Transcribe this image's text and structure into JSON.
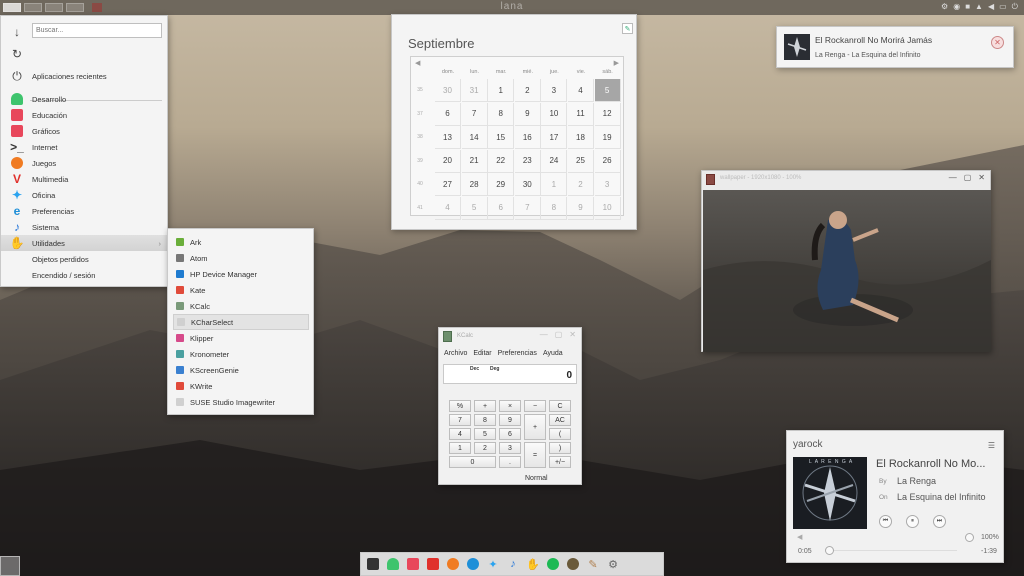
{
  "top_panel": {
    "title": "lana",
    "desktops": [
      "",
      "",
      "",
      ""
    ]
  },
  "app_menu": {
    "search_placeholder": "Buscar...",
    "recent": "Aplicaciones recientes",
    "categories": [
      {
        "label": "Desarrollo",
        "icon": "android-icon",
        "color": "#3ec46d"
      },
      {
        "label": "Educación",
        "icon": "education-icon",
        "color": "#e8475b"
      },
      {
        "label": "Gráficos",
        "icon": "graphics-icon",
        "color": "#e8475b"
      },
      {
        "label": "Internet",
        "icon": "terminal-icon",
        "color": "#333333"
      },
      {
        "label": "Juegos",
        "icon": "firefox-icon",
        "color": "#f07b22"
      },
      {
        "label": "Multimedia",
        "icon": "vivaldi-icon",
        "color": "#e0312c"
      },
      {
        "label": "Oficina",
        "icon": "twitter-icon",
        "color": "#2aa3ef"
      },
      {
        "label": "Preferencias",
        "icon": "edge-icon",
        "color": "#1e8fd8"
      },
      {
        "label": "Sistema",
        "icon": "music-note-icon",
        "color": "#2a79d8"
      },
      {
        "label": "Utilidades",
        "icon": "hand-icon",
        "color": "#f0a040"
      },
      {
        "label": "Objetos perdidos",
        "icon": "",
        "color": ""
      },
      {
        "label": "Encendido / sesión",
        "icon": "",
        "color": ""
      }
    ]
  },
  "utilities_menu": {
    "items": [
      {
        "label": "Ark",
        "color": "#6aae3a"
      },
      {
        "label": "Atom",
        "color": "#777777"
      },
      {
        "label": "HP Device Manager",
        "color": "#1f7bcf"
      },
      {
        "label": "Kate",
        "color": "#e04a3a"
      },
      {
        "label": "KCalc",
        "color": "#7a9a7a"
      },
      {
        "label": "KCharSelect",
        "color": "#d0d0d0"
      },
      {
        "label": "Klipper",
        "color": "#d64a8a"
      },
      {
        "label": "Kronometer",
        "color": "#4aa0a0"
      },
      {
        "label": "KScreenGenie",
        "color": "#3a80d0"
      },
      {
        "label": "KWrite",
        "color": "#e04a3a"
      },
      {
        "label": "SUSE Studio Imagewriter",
        "color": "#d0d0d0"
      }
    ]
  },
  "calendar": {
    "month": "Septiembre",
    "day_headers": [
      "dom.",
      "lun.",
      "mar.",
      "mié.",
      "jue.",
      "vie.",
      "sáb."
    ],
    "weeks": [
      {
        "wk": "35",
        "days": [
          [
            "30",
            true
          ],
          [
            "31",
            true
          ],
          [
            "1",
            false
          ],
          [
            "2",
            false
          ],
          [
            "3",
            false
          ],
          [
            "4",
            false
          ],
          [
            "5",
            false
          ]
        ]
      },
      {
        "wk": "37",
        "days": [
          [
            "6",
            false
          ],
          [
            "7",
            false
          ],
          [
            "8",
            false
          ],
          [
            "9",
            false
          ],
          [
            "10",
            false
          ],
          [
            "11",
            false
          ],
          [
            "12",
            false
          ]
        ]
      },
      {
        "wk": "38",
        "days": [
          [
            "13",
            false
          ],
          [
            "14",
            false
          ],
          [
            "15",
            false
          ],
          [
            "16",
            false
          ],
          [
            "17",
            false
          ],
          [
            "18",
            false
          ],
          [
            "19",
            false
          ]
        ]
      },
      {
        "wk": "39",
        "days": [
          [
            "20",
            false
          ],
          [
            "21",
            false
          ],
          [
            "22",
            false
          ],
          [
            "23",
            false
          ],
          [
            "24",
            false
          ],
          [
            "25",
            false
          ],
          [
            "26",
            false
          ]
        ]
      },
      {
        "wk": "40",
        "days": [
          [
            "27",
            false
          ],
          [
            "28",
            false
          ],
          [
            "29",
            false
          ],
          [
            "30",
            false
          ],
          [
            "1",
            true
          ],
          [
            "2",
            true
          ],
          [
            "3",
            true
          ]
        ]
      },
      {
        "wk": "41",
        "days": [
          [
            "4",
            true
          ],
          [
            "5",
            true
          ],
          [
            "6",
            true
          ],
          [
            "7",
            true
          ],
          [
            "8",
            true
          ],
          [
            "9",
            true
          ],
          [
            "10",
            true
          ]
        ]
      }
    ],
    "today": "5"
  },
  "notification": {
    "title": "El Rockanroll No Morirá Jamás",
    "subtitle": "La Renga - La Esquina del Infinito"
  },
  "viewer": {
    "title": "wallpaper - 1920x1080 - 100%"
  },
  "kcalc": {
    "title": "KCalc",
    "menu": [
      "Archivo",
      "Editar",
      "Preferencias",
      "Ayuda"
    ],
    "mode_dec": "Dec",
    "mode_deg": "Deg",
    "display": "0",
    "mode_label": "Normal",
    "buttons": [
      "%",
      "+",
      "×",
      "−",
      "C",
      "7",
      "8",
      "9",
      "+",
      "AC",
      "4",
      "5",
      "6",
      "(",
      "1",
      "2",
      "3",
      "=",
      ")",
      "0",
      ".",
      "+/−"
    ]
  },
  "yarock": {
    "app_name": "yarock",
    "song": "El Rockanroll No Mo...",
    "by_label": "By",
    "artist": "La Renga",
    "on_label": "On",
    "album": "La Esquina del Infinito",
    "elapsed": "0:05",
    "remaining": "-1:39",
    "volume": "100%",
    "album_art_text": "L A R E N G A"
  },
  "taskbar": {
    "items": [
      "terminal-icon",
      "android-icon",
      "education-icon",
      "vivaldi-icon",
      "firefox-icon",
      "edge-icon",
      "twitter-icon",
      "music-note-icon",
      "hand-icon",
      "spotify-icon",
      "paint-icon",
      "brush-icon",
      "settings-icon"
    ]
  }
}
